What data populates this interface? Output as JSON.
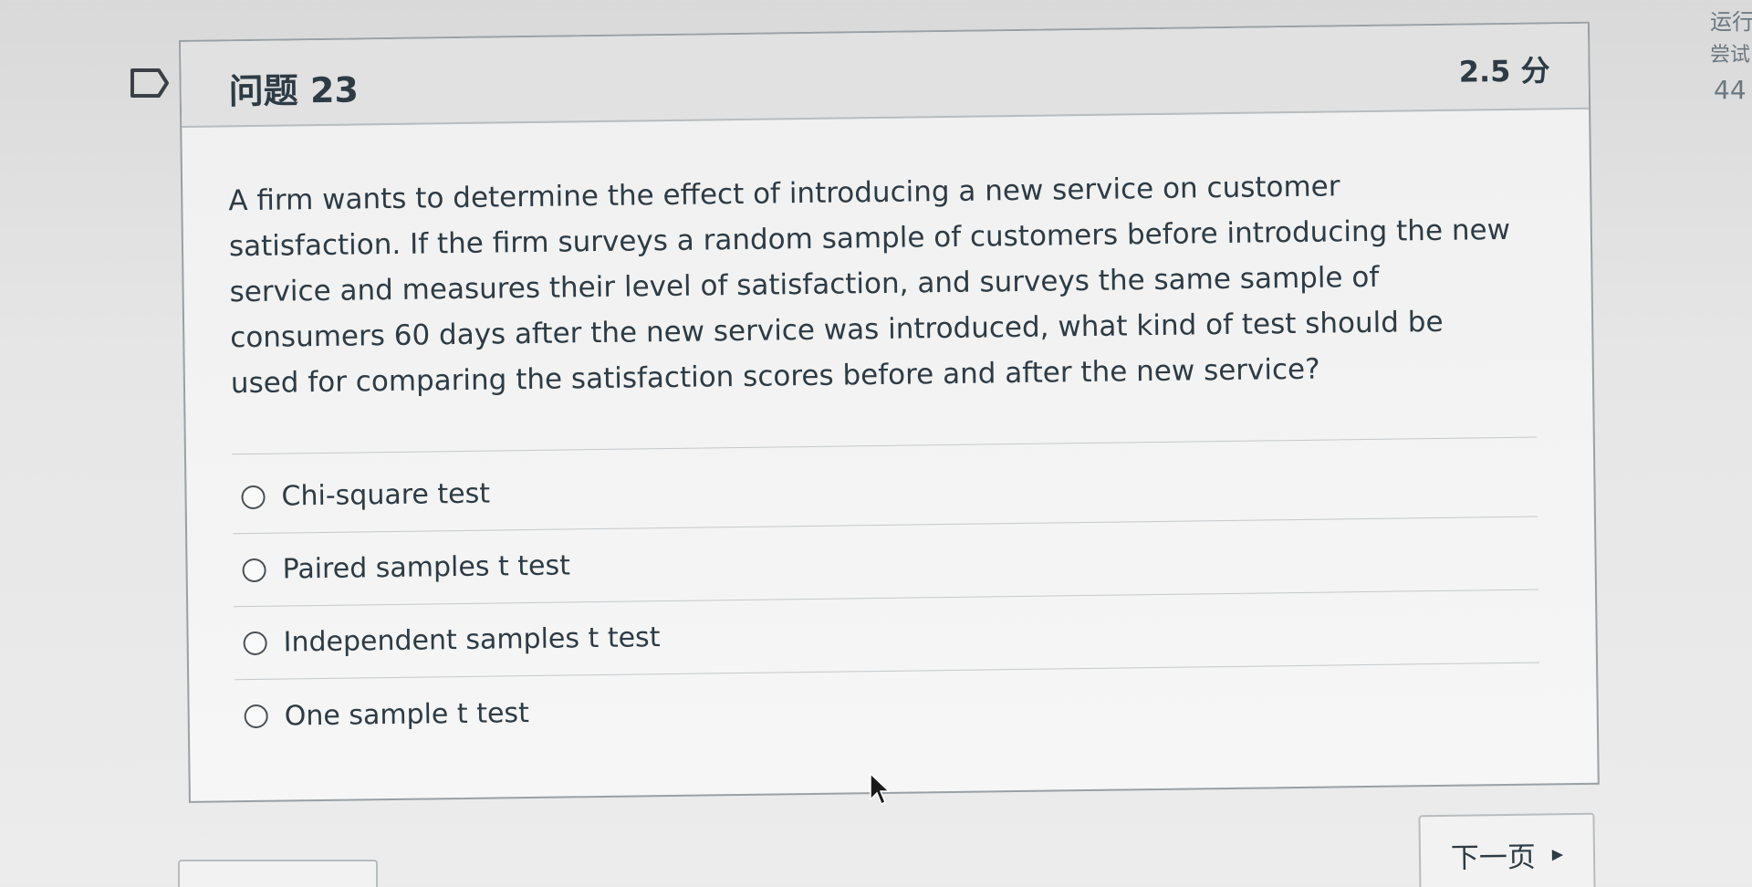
{
  "question": {
    "title": "问题 23",
    "points": "2.5 分",
    "text": "A firm wants to determine the effect of introducing a new service on customer satisfaction. If the firm surveys a random sample of customers before introducing the new service and measures their level of satisfaction, and surveys the same sample of consumers 60 days after the new service was introduced, what kind of test should be used for comparing the satisfaction scores before and after the new service?",
    "answers": [
      {
        "label": "Chi-square test"
      },
      {
        "label": "Paired samples t test"
      },
      {
        "label": "Independent samples t test"
      },
      {
        "label": "One sample t test"
      }
    ]
  },
  "navigation": {
    "next_label": "下一页",
    "next_icon": "triangle-right-icon"
  },
  "side_panel": {
    "line1": "运行",
    "line2": "尝试",
    "line3": "44"
  },
  "icons": {
    "flag": "flag-icon",
    "radio": "radio-empty-icon",
    "cursor": "mouse-pointer-icon"
  }
}
